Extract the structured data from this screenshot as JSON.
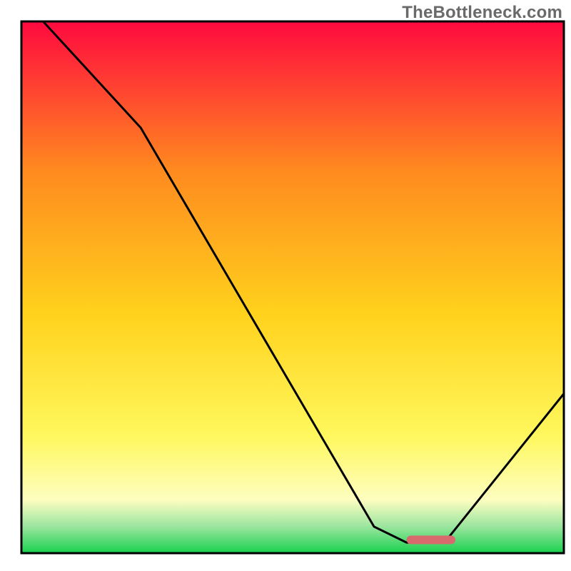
{
  "watermark": "TheBottleneck.com",
  "colors": {
    "border": "#000000",
    "curve": "#000000",
    "marker": "#d86a6e",
    "grad_top": "#ff093f",
    "grad_upper_mid": "#ff8a1f",
    "grad_mid": "#ffd21c",
    "grad_lower_mid": "#fff85e",
    "grad_pale_yellow": "#fdfec0",
    "grad_green_top": "#9be59f",
    "grad_green_bottom": "#18d14e"
  },
  "chart_data": {
    "type": "line",
    "title": "",
    "xlabel": "",
    "ylabel": "",
    "x_range": [
      0,
      100
    ],
    "y_range": [
      0,
      100
    ],
    "curve": [
      {
        "x": 4,
        "y": 100
      },
      {
        "x": 22,
        "y": 80
      },
      {
        "x": 65,
        "y": 5
      },
      {
        "x": 71,
        "y": 2
      },
      {
        "x": 78,
        "y": 2
      },
      {
        "x": 100,
        "y": 30
      }
    ],
    "optimum_marker": {
      "x_start": 71,
      "x_end": 80,
      "y": 2.5,
      "thickness_px": 12
    },
    "gradient_zones_note": "red=high bottleneck, green=low bottleneck; optimum at marker"
  }
}
